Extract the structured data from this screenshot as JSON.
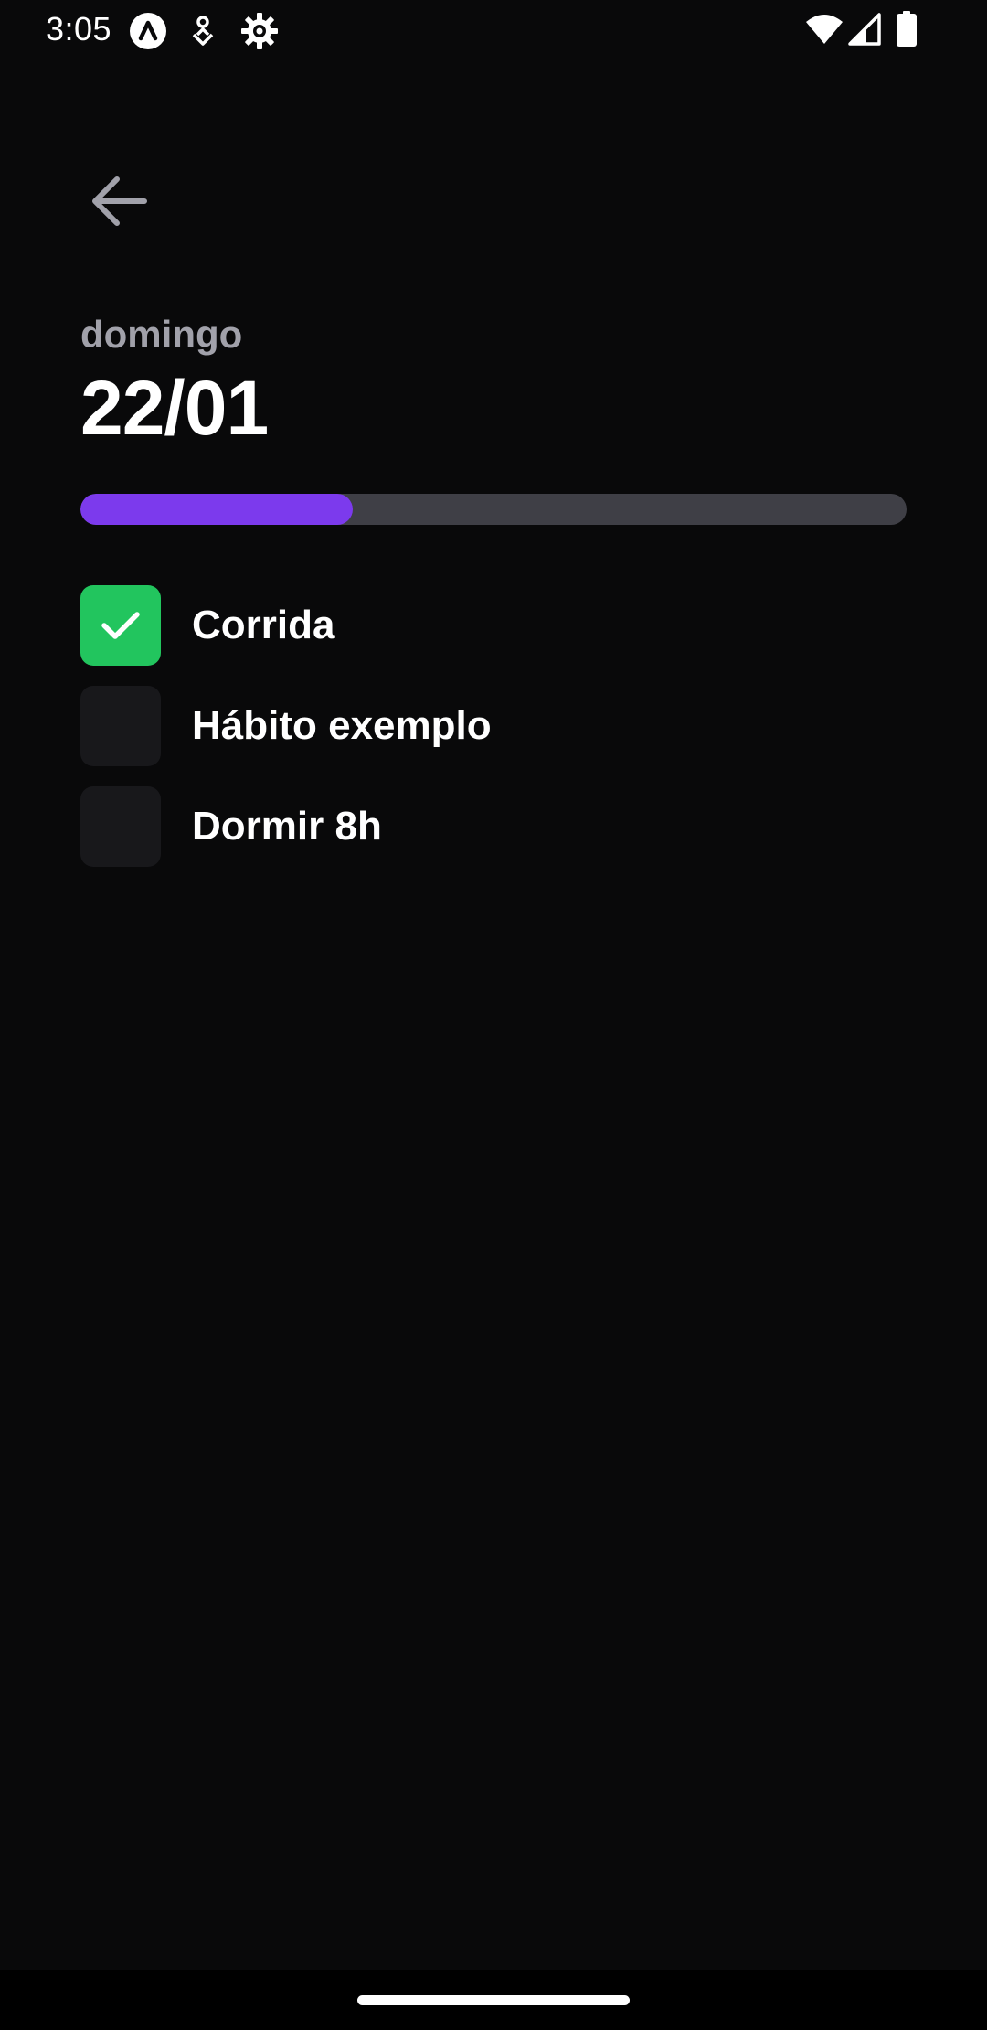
{
  "status_bar": {
    "time": "3:05",
    "icons": [
      "app-notification-icon",
      "location-pin-icon",
      "settings-gear-icon",
      "wifi-icon",
      "cell-signal-icon",
      "battery-icon"
    ]
  },
  "header": {
    "back_icon": "arrow-left-icon"
  },
  "day": {
    "weekday": "domingo",
    "date": "22/01"
  },
  "progress": {
    "completed_fraction": 0.33,
    "fill_color": "#7c3aed",
    "track_color": "#3f3f46"
  },
  "habits": [
    {
      "label": "Corrida",
      "checked": true
    },
    {
      "label": "Hábito exemplo",
      "checked": false
    },
    {
      "label": "Dormir 8h",
      "checked": false
    }
  ],
  "colors": {
    "background": "#09090a",
    "checked": "#22c55e",
    "unchecked": "#18181b",
    "muted_text": "#a1a1aa"
  }
}
